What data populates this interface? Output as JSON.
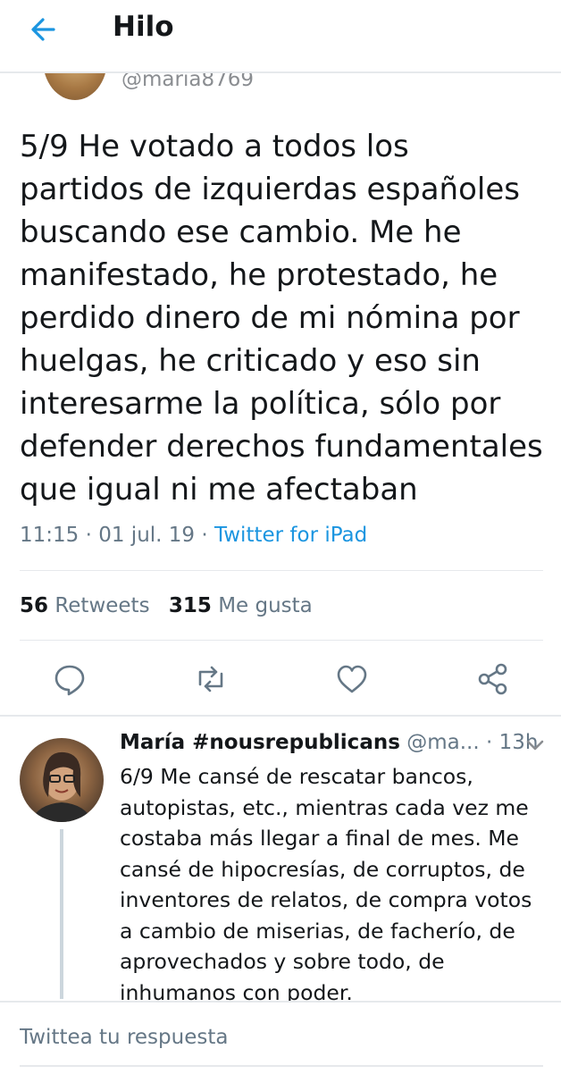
{
  "header": {
    "title": "Hilo"
  },
  "main_tweet": {
    "handle": "@maria8769",
    "text": "5/9 He votado a todos los\npartidos de izquierdas españoles\nbuscando ese cambio. Me he\nmanifestado, he protestado, he\nperdido dinero de mi nómina por\nhuelgas, he criticado y eso sin\ninteresarme la política, sólo por\ndefender derechos fundamentales\nque igual ni me afectaban",
    "time": "11:15",
    "date": "01 jul. 19",
    "separator": "·",
    "source": "Twitter for iPad",
    "retweets_count": "56",
    "retweets_label": "Retweets",
    "likes_count": "315",
    "likes_label": "Me gusta"
  },
  "actions": [
    "reply-icon",
    "retweet-icon",
    "like-icon",
    "share-icon"
  ],
  "reply": {
    "name": "María #nousrepublicans",
    "handle": "@ma...",
    "separator": "·",
    "time": "13h",
    "text": "6/9 Me cansé de rescatar bancos, autopistas, etc., mientras cada vez me costaba más llegar a final de mes. Me cansé de hipocresías, de corruptos, de inventores de relatos, de compra votos a cambio de miserias, de facherío, de aprovechados y sobre todo, de inhumanos con poder."
  },
  "compose": {
    "placeholder": "Twittea tu respuesta"
  },
  "colors": {
    "accent": "#1b95e0",
    "muted": "#657786",
    "text": "#14171a",
    "divider": "#e6e9ec"
  }
}
